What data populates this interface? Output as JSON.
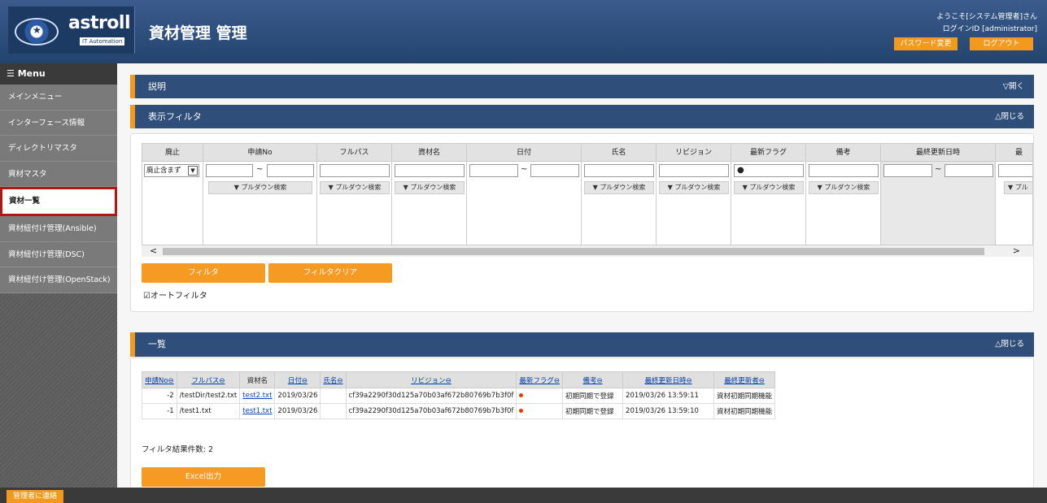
{
  "header": {
    "logo_text": "astroll",
    "logo_sub": "IT Automation",
    "title": "資材管理 管理",
    "welcome": "ようこそ[システム管理者]さん",
    "login_id": "ログインID [administrator]",
    "password_btn": "パスワード変更",
    "logout_btn": "ログアウト"
  },
  "sidebar": {
    "menu_label": "☰ Menu",
    "items": [
      {
        "label": "メインメニュー"
      },
      {
        "label": "インターフェース情報"
      },
      {
        "label": "ディレクトリマスタ"
      },
      {
        "label": "資材マスタ"
      },
      {
        "label": "資材一覧"
      },
      {
        "label": "資材紐付け管理(Ansible)"
      },
      {
        "label": "資材紐付け管理(DSC)"
      },
      {
        "label": "資材紐付け管理(OpenStack)"
      }
    ]
  },
  "panels": {
    "desc_title": "説明",
    "desc_toggle": "▽開く",
    "filter_title": "表示フィルタ",
    "filter_toggle": "△閉じる",
    "list_title": "一覧",
    "list_toggle": "△閉じる"
  },
  "filter": {
    "columns": [
      "廃止",
      "申請No",
      "フルパス",
      "資材名",
      "日付",
      "氏名",
      "リビジョン",
      "最新フラグ",
      "備考",
      "最終更新日時",
      "最"
    ],
    "discard_select": "廃止含まず",
    "pulldown": "▼ プルダウン検索",
    "pulldown_short": "▼ プル",
    "tilde": "~",
    "flag_value": "●",
    "filter_btn": "フィルタ",
    "clear_btn": "フィルタクリア",
    "auto_filter": "☑オートフィルタ"
  },
  "table": {
    "headers": [
      "申請No⊖",
      "フルパス⊖",
      "資材名",
      "日付⊖",
      "氏名⊖",
      "リビジョン⊖",
      "最新フラグ⊖",
      "備考⊖",
      "最終更新日時⊖",
      "最終更新者⊖"
    ],
    "rows": [
      {
        "no": "-2",
        "path": "/testDir/test2.txt",
        "name": "test2.txt",
        "date": "2019/03/26",
        "person": "",
        "revision": "cf39a2290f30d125a70b03af672b80769b7b3f0f",
        "note": "初期同期で登録",
        "updated": "2019/03/26 13:59:11",
        "updater": "資材初期同期機能"
      },
      {
        "no": "-1",
        "path": "/test1.txt",
        "name": "test1.txt",
        "date": "2019/03/26",
        "person": "",
        "revision": "cf39a2290f30d125a70b03af672b80769b7b3f0f",
        "note": "初期同期で登録",
        "updated": "2019/03/26 13:59:10",
        "updater": "資材初期同期機能"
      }
    ],
    "result_count": "フィルタ結果件数: 2",
    "excel_btn": "Excel出力"
  },
  "footer": {
    "contact_btn": "管理者に連絡"
  }
}
